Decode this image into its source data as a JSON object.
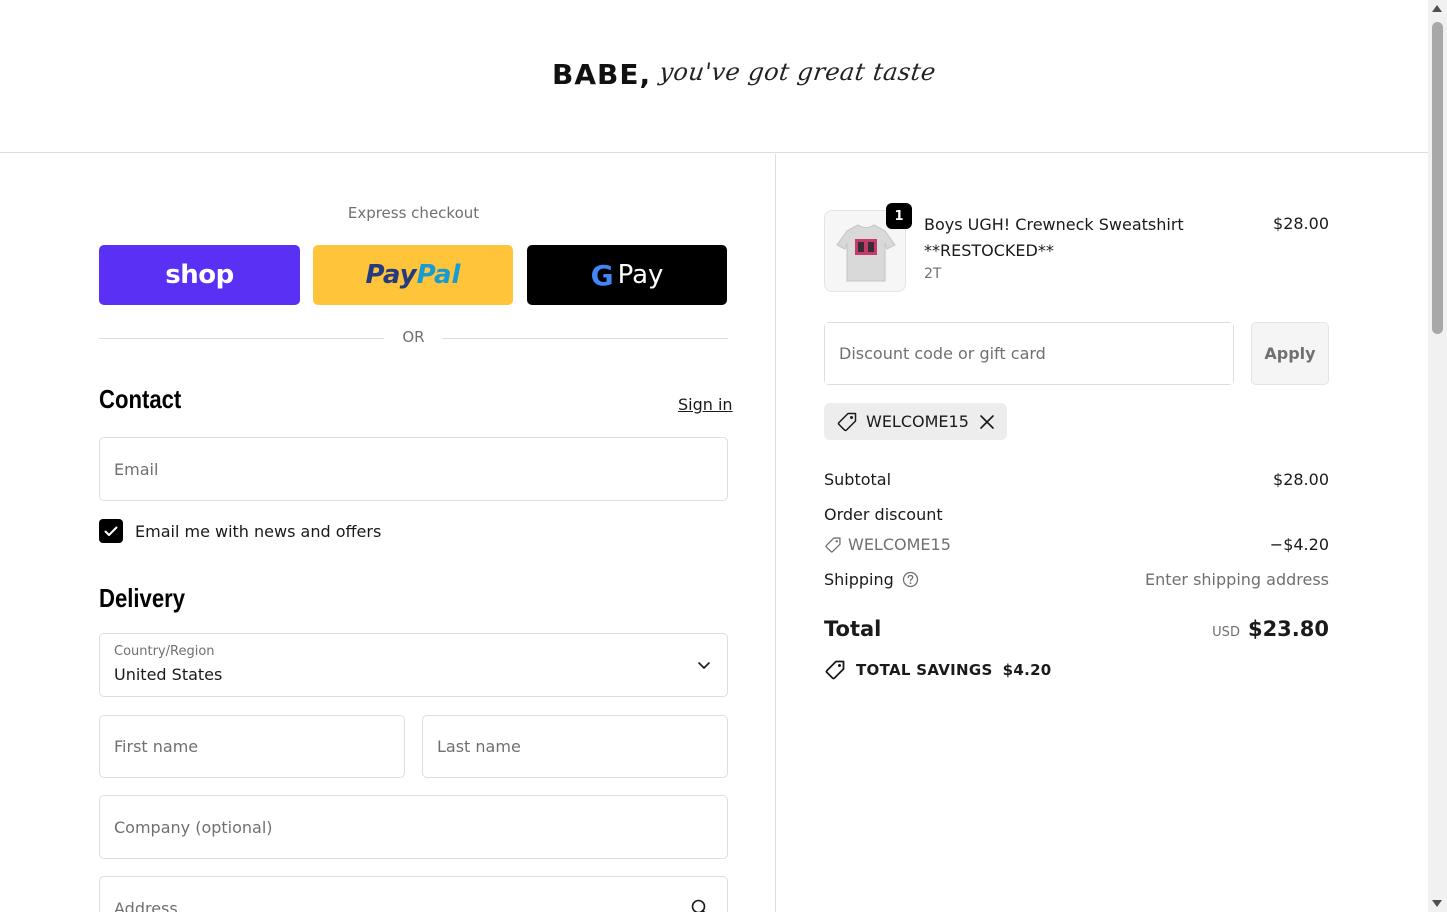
{
  "header": {
    "logo_bold": "BABE,",
    "logo_script": "you've got great taste"
  },
  "express": {
    "label": "Express checkout",
    "shop_label": "shop",
    "paypal_part1": "Pay",
    "paypal_part2": "Pal",
    "gpay_g": "G",
    "gpay_label": "Pay",
    "or_label": "OR"
  },
  "contact": {
    "title": "Contact",
    "sign_in": "Sign in",
    "email_placeholder": "Email",
    "newsletter_label": "Email me with news and offers",
    "newsletter_checked": true
  },
  "delivery": {
    "title": "Delivery",
    "country_label": "Country/Region",
    "country_value": "United States",
    "first_name_placeholder": "First name",
    "last_name_placeholder": "Last name",
    "company_placeholder": "Company (optional)",
    "address_placeholder": "Address"
  },
  "order": {
    "item": {
      "quantity": "1",
      "name": "Boys UGH! Crewneck Sweatshirt **RESTOCKED**",
      "variant": "2T",
      "price": "$28.00"
    },
    "discount_placeholder": "Discount code or gift card",
    "apply_label": "Apply",
    "applied_code": "WELCOME15",
    "subtotal_label": "Subtotal",
    "subtotal_value": "$28.00",
    "order_discount_label": "Order discount",
    "discount_code": "WELCOME15",
    "discount_value": "−$4.20",
    "shipping_label": "Shipping",
    "shipping_value": "Enter shipping address",
    "total_label": "Total",
    "total_currency": "USD",
    "total_value": "$23.80",
    "savings_label": "TOTAL SAVINGS",
    "savings_value": "$4.20"
  },
  "colors": {
    "shop_pay": "#5a31f4",
    "paypal": "#ffc439",
    "gpay": "#000000"
  }
}
